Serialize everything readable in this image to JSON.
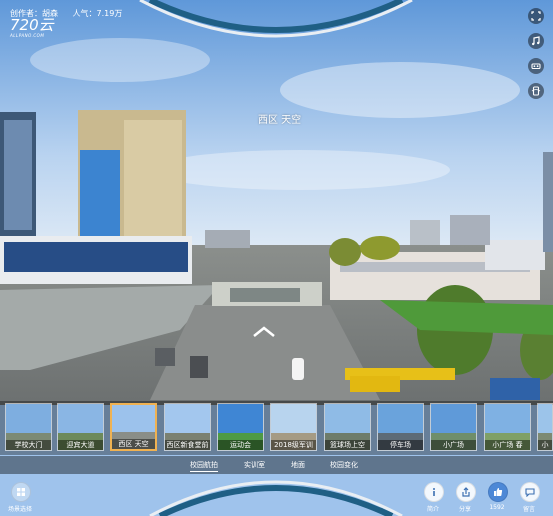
{
  "header": {
    "author_label": "创作者：胡森",
    "views_label": "人气：7.19万",
    "logo_text": "720云",
    "logo_sub": "ALLPANO.COM"
  },
  "scene": {
    "hotspot_label": "西区 天空"
  },
  "right_toolbar": {
    "icons": [
      "fullscreen-icon",
      "music-icon",
      "vr-icon",
      "gyroscope-icon"
    ]
  },
  "thumbnails": [
    {
      "label": "学校大门"
    },
    {
      "label": "迎宾大道"
    },
    {
      "label": "西区 天空",
      "selected": true
    },
    {
      "label": "西区新食堂前"
    },
    {
      "label": "运动会"
    },
    {
      "label": "2018级军训"
    },
    {
      "label": "篮球场上空"
    },
    {
      "label": "停车场"
    },
    {
      "label": "小广场"
    },
    {
      "label": "小广场 春"
    },
    {
      "label": "小"
    }
  ],
  "tabs": [
    {
      "label": "校园航拍",
      "active": true
    },
    {
      "label": "实训室"
    },
    {
      "label": "地面"
    },
    {
      "label": "校园变化"
    }
  ],
  "bottom_left": {
    "label": "场景选择"
  },
  "bottom_right": [
    {
      "label": "简介",
      "icon": "info-icon"
    },
    {
      "label": "分享",
      "icon": "share-icon"
    },
    {
      "label": "1592",
      "icon": "thumbs-up-icon"
    },
    {
      "label": "留言",
      "icon": "comment-icon"
    }
  ]
}
